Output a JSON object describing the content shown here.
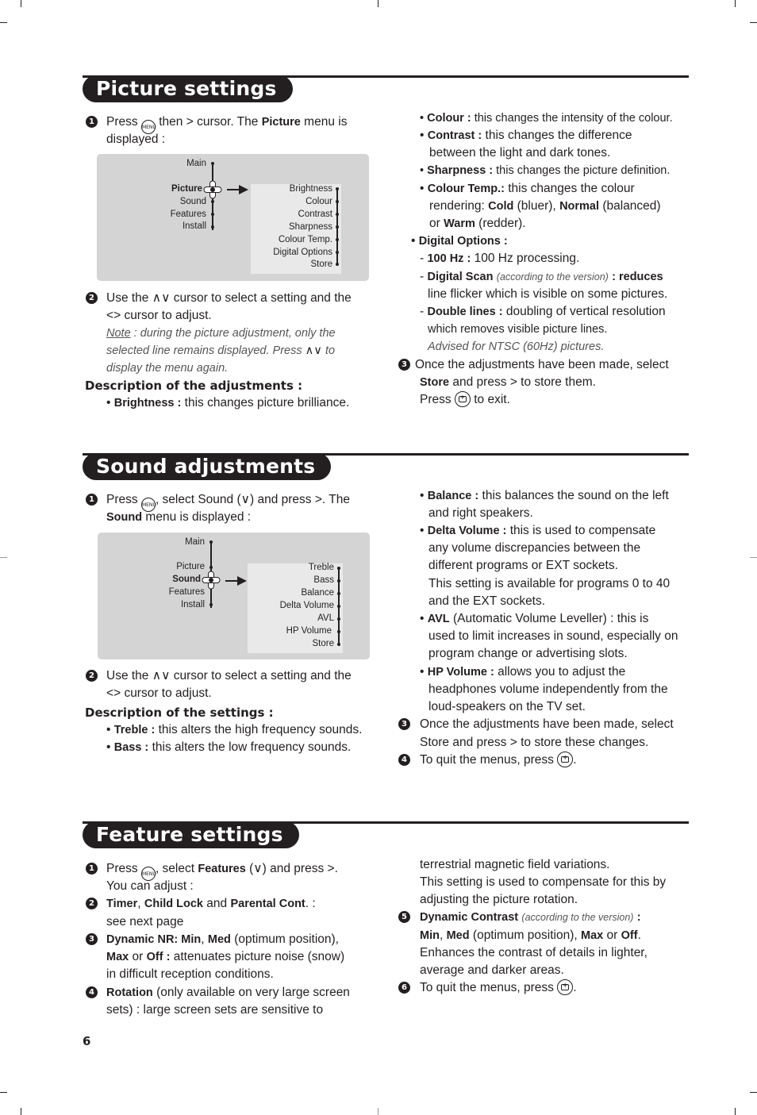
{
  "page_number": "6",
  "icons": {
    "menu_key": "MENU",
    "cursor_right": ">",
    "cursor_left": "<",
    "cursor_up": "∧",
    "cursor_down": "∨",
    "exit_key": "info-plus-key-icon"
  },
  "picture": {
    "title": "Picture settings",
    "step1": {
      "num": "1",
      "a": "Press",
      "b": "then",
      "c": "cursor. The",
      "bold": "Picture",
      "d": "menu is",
      "line2": "displayed :"
    },
    "menu": {
      "main": [
        "Main",
        "Picture",
        "Sound",
        "Features",
        "Install"
      ],
      "selected": "Picture",
      "sub": [
        "Brightness",
        "Colour",
        "Contrast",
        "Sharpness",
        "Colour Temp.",
        "Digital Options",
        "Store"
      ]
    },
    "step2": {
      "num": "2",
      "line1a": "Use the",
      "line1b": "cursor to select a setting and the",
      "line2": "cursor to adjust.",
      "note_label": "Note",
      "note1": ": during the picture adjustment, only the",
      "note2a": "selected line remains displayed. Press",
      "note2b": "to",
      "note3": "display the menu again."
    },
    "desc_header": "Description of the adjustments :",
    "brightness": {
      "term": "Brightness :",
      "text": "this changes picture brilliance."
    },
    "colour": {
      "term": "Colour :",
      "text": "this changes the intensity of the colour."
    },
    "contrast": {
      "term": "Contrast :",
      "text": "this changes the difference",
      "line2": "between the light and dark tones."
    },
    "sharpness": {
      "term": "Sharpness :",
      "text": "this changes the picture definition."
    },
    "colour_temp": {
      "term": "Colour Temp.:",
      "text": "this changes the colour",
      "l2a": "rendering:",
      "cold": "Cold",
      "l2b": "(bluer),",
      "normal": "Normal",
      "l2c": "(balanced)",
      "l3a": "or",
      "warm": "Warm",
      "l3b": "(redder)."
    },
    "digital_options": {
      "term": "Digital Options :",
      "hz_term": "100 Hz :",
      "hz_text": "100 Hz processing.",
      "scan_term": "Digital Scan",
      "scan_note": "(according to the version)",
      "scan_colon": ": reduces",
      "scan_line2": "line flicker which is visible on some pictures.",
      "dl_term": "Double lines :",
      "dl_text": "doubling of vertical resolution",
      "dl_line2": "which removes visible picture lines.",
      "advised": "Advised for NTSC (60Hz) pictures."
    },
    "step3": {
      "num": "3",
      "line1": "Once the adjustments have been made, select",
      "store": "Store",
      "line2": "and press",
      "line2b": "to store them.",
      "line3a": "Press",
      "line3b": "to exit."
    }
  },
  "sound": {
    "title": "Sound adjustments",
    "step1": {
      "num": "1",
      "a": "Press",
      "b": ", select Sound (",
      "c": ") and press",
      "d": ". The",
      "bold": "Sound",
      "line2": "menu is displayed :"
    },
    "menu": {
      "main": [
        "Main",
        "Picture",
        "Sound",
        "Features",
        "Install"
      ],
      "selected": "Sound",
      "sub": [
        "Treble",
        "Bass",
        "Balance",
        "Delta Volume",
        "AVL",
        "HP Volume",
        "Store"
      ]
    },
    "step2": {
      "num": "2",
      "line1a": "Use the",
      "line1b": "cursor to select a setting and the",
      "line2": "cursor to adjust."
    },
    "desc_header": "Description of the settings :",
    "treble": {
      "term": "Treble :",
      "text": "this alters the high frequency sounds."
    },
    "bass": {
      "term": "Bass :",
      "text": "this alters the low frequency sounds."
    },
    "balance": {
      "term": "Balance :",
      "text": "this balances the sound on the left",
      "line2": "and right speakers."
    },
    "delta": {
      "term": "Delta Volume :",
      "text": "this is used to compensate",
      "line2": "any volume discrepancies between the",
      "line3": "different programs or EXT sockets.",
      "line4": "This setting is available for programs 0 to 40",
      "line5": "and the EXT sockets."
    },
    "avl": {
      "term": "AVL",
      "text": "(Automatic Volume Leveller) : this is",
      "line2": "used to limit increases in sound, especially on",
      "line3": "program change or advertising slots."
    },
    "hp": {
      "term": "HP Volume :",
      "text": "allows you to adjust the",
      "line2": "headphones volume independently from the",
      "line3": "loud-speakers on the TV set."
    },
    "step3": {
      "num": "3",
      "line1": "Once the adjustments have been made, select",
      "line2a": "Store and press",
      "line2b": "to store these changes."
    },
    "step4": {
      "num": "4",
      "text": "To quit the menus, press"
    }
  },
  "feature": {
    "title": "Feature settings",
    "step1": {
      "num": "1",
      "a": "Press",
      "b": ", select",
      "bold": "Features",
      "c": "(",
      "d": ") and press",
      "e": ".",
      "line2": "You can adjust :"
    },
    "step2": {
      "num": "2",
      "timer": "Timer",
      "comma": ",",
      "child": "Child Lock",
      "and": "and",
      "parental": "Parental Cont",
      "tail": ". :",
      "line2": "see next page"
    },
    "step3": {
      "num": "3",
      "term": "Dynamic NR: Min",
      "comma": ",",
      "med": "Med",
      "text": "(optimum position),",
      "max": "Max",
      "or": "or",
      "off": "Off :",
      "text2": "attenuates picture noise (snow)",
      "line3": "in difficult reception conditions."
    },
    "step4": {
      "num": "4",
      "term": "Rotation",
      "text": "(only available on very large screen",
      "line2": "sets) : large screen sets are sensitive to",
      "line3": "terrestrial magnetic field variations.",
      "line4": "This setting is used to compensate for this by",
      "line5": "adjusting the picture rotation."
    },
    "step5": {
      "num": "5",
      "term": "Dynamic Contrast",
      "note": "(according to the version)",
      "colon": ":",
      "min": "Min",
      "comma": ",",
      "med": "Med",
      "text": "(optimum position),",
      "max": "Max",
      "or": "or",
      "off": "Off",
      "dot": ".",
      "line3": "Enhances the contrast of details in lighter,",
      "line4": "average and darker areas."
    },
    "step6": {
      "num": "6",
      "text": "To quit the menus, press"
    }
  }
}
